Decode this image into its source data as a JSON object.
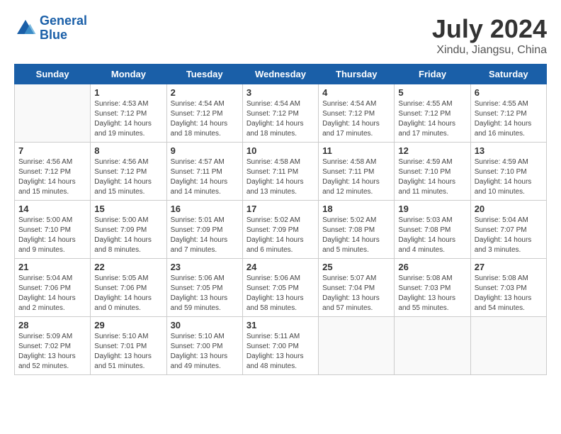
{
  "header": {
    "logo_line1": "General",
    "logo_line2": "Blue",
    "month_year": "July 2024",
    "location": "Xindu, Jiangsu, China"
  },
  "days_of_week": [
    "Sunday",
    "Monday",
    "Tuesday",
    "Wednesday",
    "Thursday",
    "Friday",
    "Saturday"
  ],
  "weeks": [
    [
      {
        "num": "",
        "info": ""
      },
      {
        "num": "1",
        "info": "Sunrise: 4:53 AM\nSunset: 7:12 PM\nDaylight: 14 hours\nand 19 minutes."
      },
      {
        "num": "2",
        "info": "Sunrise: 4:54 AM\nSunset: 7:12 PM\nDaylight: 14 hours\nand 18 minutes."
      },
      {
        "num": "3",
        "info": "Sunrise: 4:54 AM\nSunset: 7:12 PM\nDaylight: 14 hours\nand 18 minutes."
      },
      {
        "num": "4",
        "info": "Sunrise: 4:54 AM\nSunset: 7:12 PM\nDaylight: 14 hours\nand 17 minutes."
      },
      {
        "num": "5",
        "info": "Sunrise: 4:55 AM\nSunset: 7:12 PM\nDaylight: 14 hours\nand 17 minutes."
      },
      {
        "num": "6",
        "info": "Sunrise: 4:55 AM\nSunset: 7:12 PM\nDaylight: 14 hours\nand 16 minutes."
      }
    ],
    [
      {
        "num": "7",
        "info": "Sunrise: 4:56 AM\nSunset: 7:12 PM\nDaylight: 14 hours\nand 15 minutes."
      },
      {
        "num": "8",
        "info": "Sunrise: 4:56 AM\nSunset: 7:12 PM\nDaylight: 14 hours\nand 15 minutes."
      },
      {
        "num": "9",
        "info": "Sunrise: 4:57 AM\nSunset: 7:11 PM\nDaylight: 14 hours\nand 14 minutes."
      },
      {
        "num": "10",
        "info": "Sunrise: 4:58 AM\nSunset: 7:11 PM\nDaylight: 14 hours\nand 13 minutes."
      },
      {
        "num": "11",
        "info": "Sunrise: 4:58 AM\nSunset: 7:11 PM\nDaylight: 14 hours\nand 12 minutes."
      },
      {
        "num": "12",
        "info": "Sunrise: 4:59 AM\nSunset: 7:10 PM\nDaylight: 14 hours\nand 11 minutes."
      },
      {
        "num": "13",
        "info": "Sunrise: 4:59 AM\nSunset: 7:10 PM\nDaylight: 14 hours\nand 10 minutes."
      }
    ],
    [
      {
        "num": "14",
        "info": "Sunrise: 5:00 AM\nSunset: 7:10 PM\nDaylight: 14 hours\nand 9 minutes."
      },
      {
        "num": "15",
        "info": "Sunrise: 5:00 AM\nSunset: 7:09 PM\nDaylight: 14 hours\nand 8 minutes."
      },
      {
        "num": "16",
        "info": "Sunrise: 5:01 AM\nSunset: 7:09 PM\nDaylight: 14 hours\nand 7 minutes."
      },
      {
        "num": "17",
        "info": "Sunrise: 5:02 AM\nSunset: 7:09 PM\nDaylight: 14 hours\nand 6 minutes."
      },
      {
        "num": "18",
        "info": "Sunrise: 5:02 AM\nSunset: 7:08 PM\nDaylight: 14 hours\nand 5 minutes."
      },
      {
        "num": "19",
        "info": "Sunrise: 5:03 AM\nSunset: 7:08 PM\nDaylight: 14 hours\nand 4 minutes."
      },
      {
        "num": "20",
        "info": "Sunrise: 5:04 AM\nSunset: 7:07 PM\nDaylight: 14 hours\nand 3 minutes."
      }
    ],
    [
      {
        "num": "21",
        "info": "Sunrise: 5:04 AM\nSunset: 7:06 PM\nDaylight: 14 hours\nand 2 minutes."
      },
      {
        "num": "22",
        "info": "Sunrise: 5:05 AM\nSunset: 7:06 PM\nDaylight: 14 hours\nand 0 minutes."
      },
      {
        "num": "23",
        "info": "Sunrise: 5:06 AM\nSunset: 7:05 PM\nDaylight: 13 hours\nand 59 minutes."
      },
      {
        "num": "24",
        "info": "Sunrise: 5:06 AM\nSunset: 7:05 PM\nDaylight: 13 hours\nand 58 minutes."
      },
      {
        "num": "25",
        "info": "Sunrise: 5:07 AM\nSunset: 7:04 PM\nDaylight: 13 hours\nand 57 minutes."
      },
      {
        "num": "26",
        "info": "Sunrise: 5:08 AM\nSunset: 7:03 PM\nDaylight: 13 hours\nand 55 minutes."
      },
      {
        "num": "27",
        "info": "Sunrise: 5:08 AM\nSunset: 7:03 PM\nDaylight: 13 hours\nand 54 minutes."
      }
    ],
    [
      {
        "num": "28",
        "info": "Sunrise: 5:09 AM\nSunset: 7:02 PM\nDaylight: 13 hours\nand 52 minutes."
      },
      {
        "num": "29",
        "info": "Sunrise: 5:10 AM\nSunset: 7:01 PM\nDaylight: 13 hours\nand 51 minutes."
      },
      {
        "num": "30",
        "info": "Sunrise: 5:10 AM\nSunset: 7:00 PM\nDaylight: 13 hours\nand 49 minutes."
      },
      {
        "num": "31",
        "info": "Sunrise: 5:11 AM\nSunset: 7:00 PM\nDaylight: 13 hours\nand 48 minutes."
      },
      {
        "num": "",
        "info": ""
      },
      {
        "num": "",
        "info": ""
      },
      {
        "num": "",
        "info": ""
      }
    ]
  ]
}
